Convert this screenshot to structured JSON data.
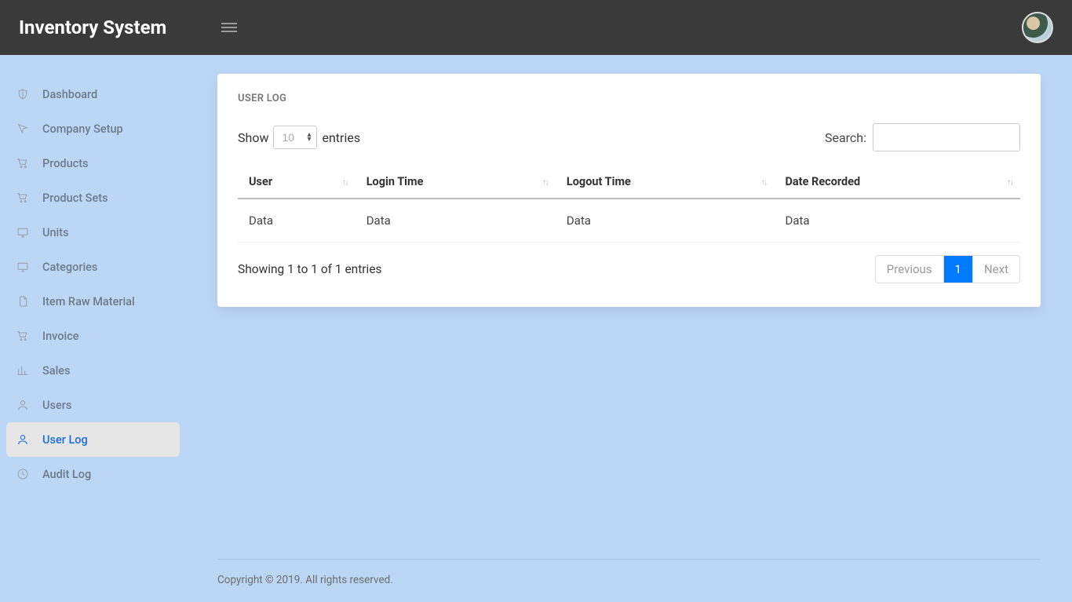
{
  "header": {
    "brand": "Inventory System"
  },
  "sidebar": {
    "items": [
      {
        "label": "Dashboard",
        "icon": "shield"
      },
      {
        "label": "Company Setup",
        "icon": "cursor"
      },
      {
        "label": "Products",
        "icon": "cart"
      },
      {
        "label": "Product Sets",
        "icon": "cart"
      },
      {
        "label": "Units",
        "icon": "monitor"
      },
      {
        "label": "Categories",
        "icon": "monitor"
      },
      {
        "label": "Item Raw Material",
        "icon": "file"
      },
      {
        "label": "Invoice",
        "icon": "cart"
      },
      {
        "label": "Sales",
        "icon": "bars"
      },
      {
        "label": "Users",
        "icon": "user"
      },
      {
        "label": "User Log",
        "icon": "user",
        "active": true
      },
      {
        "label": "Audit Log",
        "icon": "clock"
      }
    ]
  },
  "card": {
    "title": "USER LOG",
    "show_label_pre": "Show",
    "show_label_post": "entries",
    "show_value": "10",
    "search_label": "Search:",
    "columns": [
      "User",
      "Login Time",
      "Logout Time",
      "Date Recorded"
    ],
    "rows": [
      [
        "Data",
        "Data",
        "Data",
        "Data"
      ]
    ],
    "info": "Showing 1 to 1 of 1 entries",
    "pagination": {
      "prev": "Previous",
      "pages": [
        "1"
      ],
      "next": "Next"
    }
  },
  "footer": {
    "text": "Copyright © 2019. All rights reserved."
  }
}
